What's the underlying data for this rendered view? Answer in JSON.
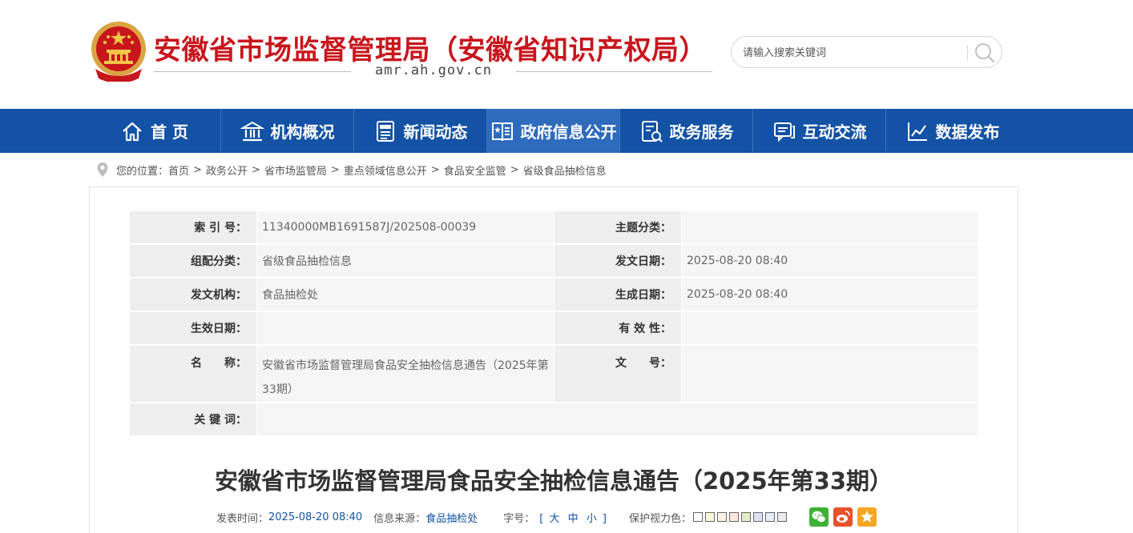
{
  "header": {
    "emblem_icon": "national-emblem-icon",
    "title": "安徽省市场监督管理局（安徽省知识产权局）",
    "domain": "amr.ah.gov.cn",
    "search": {
      "placeholder": "请输入搜索关键词",
      "icon": "search-icon"
    }
  },
  "colors": {
    "title_red": "#c8161d",
    "nav_blue": "#1352a4",
    "nav_active": "#2e6bbc",
    "link_blue": "#1352a4"
  },
  "nav": {
    "items": [
      {
        "label": "首 页",
        "icon": "home-icon"
      },
      {
        "label": "机构概况",
        "icon": "institution-icon"
      },
      {
        "label": "新闻动态",
        "icon": "news-icon"
      },
      {
        "label": "政府信息公开",
        "icon": "gov-info-icon",
        "active": true
      },
      {
        "label": "政务服务",
        "icon": "service-icon"
      },
      {
        "label": "互动交流",
        "icon": "chat-icon"
      },
      {
        "label": "数据发布",
        "icon": "chart-icon"
      }
    ]
  },
  "breadcrumb": {
    "prefix": "您的位置：",
    "items": [
      "首页",
      "政务公开",
      "省市场监管局",
      "重点领域信息公开",
      "食品安全监管",
      "省级食品抽检信息"
    ],
    "separator": ">"
  },
  "meta": {
    "index_label": "索 引 号：",
    "index_value": "11340000MB1691587J/202508-00039",
    "topic_label": "主题分类：",
    "topic_value": "",
    "group_label": "组配分类：",
    "group_value": "省级食品抽检信息",
    "issue_date_label": "发文日期：",
    "issue_date_value": "2025-08-20 08:40",
    "org_label": "发文机构：",
    "org_value": "食品抽检处",
    "gen_date_label": "生成日期：",
    "gen_date_value": "2025-08-20 08:40",
    "effective_label": "生效日期：",
    "effective_value": "",
    "validity_label": "有 效 性：",
    "validity_value": "",
    "name_label": "名　　称：",
    "name_value": "安徽省市场监督管理局食品安全抽检信息通告（2025年第33期）",
    "docno_label": "文　　号：",
    "docno_value": "",
    "keywords_label": "关 键 词：",
    "keywords_value": ""
  },
  "article": {
    "title": "安徽省市场监督管理局食品安全抽检信息通告（2025年第33期）",
    "publish_label": "发表时间：",
    "publish_time": "2025-08-20 08:40",
    "source_label": "信息来源：",
    "source": "食品抽检处",
    "font_label": "字号：",
    "font_open": "[",
    "font_large": "大",
    "font_medium": "中",
    "font_small": "小",
    "font_close": "]",
    "color_label": "保护视力色：",
    "eye_colors": [
      "#ffffff",
      "#faf9de",
      "#fff2e2",
      "#fde6e0",
      "#e3edcd",
      "#dce2f1",
      "#e9ebfe",
      "#eaeaef"
    ]
  },
  "share": [
    {
      "icon": "wechat-icon",
      "color": "#3eb135"
    },
    {
      "icon": "weibo-icon",
      "color": "#e6522c"
    },
    {
      "icon": "favorite-star-icon",
      "color": "#f6a623"
    }
  ]
}
